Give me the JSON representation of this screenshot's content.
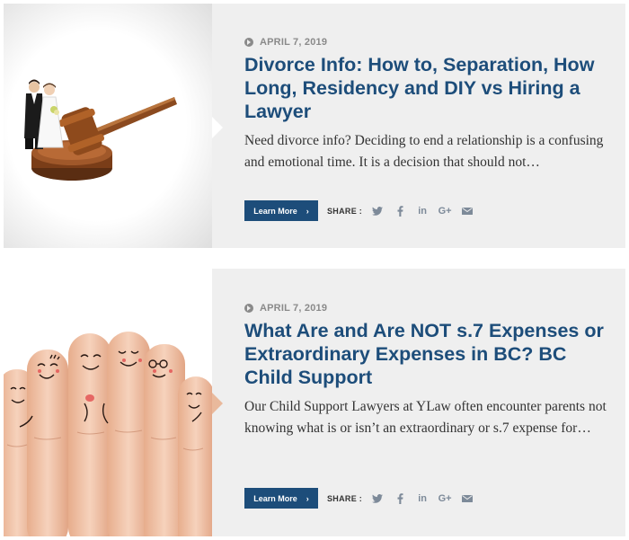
{
  "posts": [
    {
      "date": "APRIL 7, 2019",
      "title": "Divorce Info: How to, Separation, How Long, Residency and DIY vs Hiring a Lawyer",
      "excerpt": "Need divorce info? Deciding to end a relationship is a confusing and emotional time. It is a decision that should not…",
      "learn_more": "Learn More",
      "share_label": "SHARE :",
      "image": "wedding-couple-on-gavel-image"
    },
    {
      "date": "APRIL 7, 2019",
      "title": "What Are and Are NOT s.7 Expenses or Extraordinary Expenses in BC? BC Child Support",
      "excerpt": "Our Child Support Lawyers at YLaw often encounter parents not knowing what is or isn’t an extraordinary or s.7 expense for…",
      "learn_more": "Learn More",
      "share_label": "SHARE :",
      "image": "finger-faces-family-image"
    }
  ],
  "social_icons": [
    "twitter-icon",
    "facebook-icon",
    "linkedin-icon",
    "google-plus-icon",
    "email-icon"
  ],
  "social_glyphs": {
    "linkedin": "in",
    "google_plus": "G+"
  },
  "colors": {
    "title": "#1d4d7a",
    "button": "#1d4d7a",
    "card_bg": "#efefef",
    "date": "#8a8a8a",
    "icons": "#7d8a99"
  }
}
